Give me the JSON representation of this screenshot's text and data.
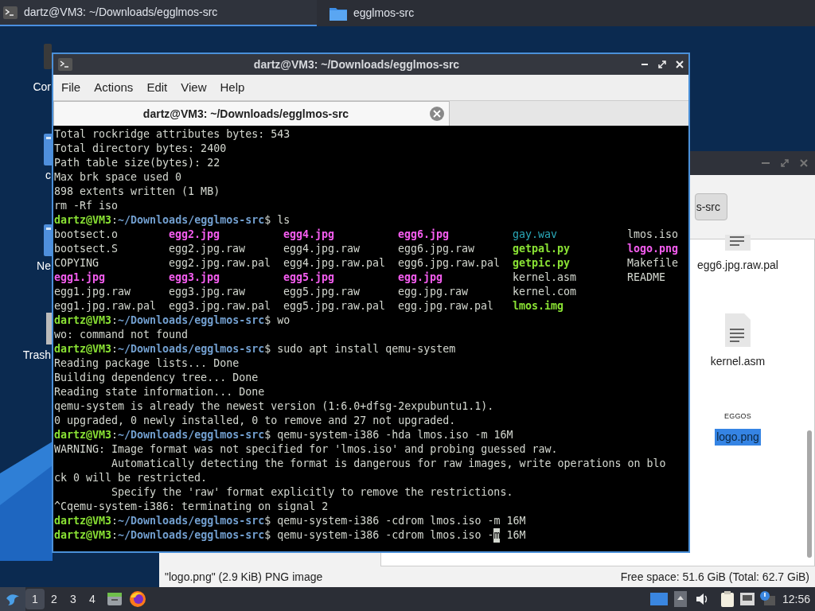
{
  "top_panel": {
    "tasks": [
      {
        "label": "dartz@VM3: ~/Downloads/egglmos-src",
        "kind": "terminal",
        "selected": true
      },
      {
        "label": "egglmos-src",
        "kind": "folder",
        "selected": false
      }
    ]
  },
  "desktop_icons": [
    {
      "label": "Cor",
      "kind": "computer"
    },
    {
      "label": "c",
      "kind": "folder"
    },
    {
      "label": "Ne",
      "kind": "folder"
    },
    {
      "label": "Trash",
      "kind": "trash"
    }
  ],
  "file_manager": {
    "path_button": "s-src",
    "files": [
      {
        "name": "egg6.jpg.raw.pal",
        "kind": "text",
        "selected": false
      },
      {
        "name": "kernel.asm",
        "kind": "text",
        "selected": false
      },
      {
        "name": "logo.png",
        "kind": "image",
        "thumbnail_text": "EGGOS",
        "selected": true
      }
    ],
    "status_left": "\"logo.png\" (2.9 KiB) PNG image",
    "status_right": "Free space: 51.6 GiB (Total: 62.7 GiB)"
  },
  "terminal": {
    "title": "dartz@VM3: ~/Downloads/egglmos-src",
    "menu": [
      "File",
      "Actions",
      "Edit",
      "View",
      "Help"
    ],
    "tab": {
      "label": "dartz@VM3: ~/Downloads/egglmos-src",
      "selected": true
    },
    "lines": [
      {
        "kind": "output",
        "text": "Total rockridge attributes bytes: 543"
      },
      {
        "kind": "output",
        "text": "Total directory bytes: 2400"
      },
      {
        "kind": "output",
        "text": "Path table size(bytes): 22"
      },
      {
        "kind": "output",
        "text": "Max brk space used 0"
      },
      {
        "kind": "output",
        "text": "898 extents written (1 MB)"
      },
      {
        "kind": "output",
        "text": "rm -Rf iso"
      },
      {
        "kind": "prompt",
        "user": "dartz@VM3",
        "separator": ":",
        "path": "~/Downloads/egglmos-src",
        "symbol": "$",
        "command": "ls"
      },
      {
        "kind": "listing",
        "rows": [
          [
            {
              "name": "bootsect.o",
              "kind": "file"
            },
            {
              "name": "egg2.jpg",
              "kind": "image"
            },
            {
              "name": "egg4.jpg",
              "kind": "image"
            },
            {
              "name": "egg6.jpg",
              "kind": "image"
            },
            {
              "name": "gay.wav",
              "kind": "audio"
            },
            {
              "name": "lmos.iso",
              "kind": "file"
            }
          ],
          [
            {
              "name": "bootsect.S",
              "kind": "file"
            },
            {
              "name": "egg2.jpg.raw",
              "kind": "file"
            },
            {
              "name": "egg4.jpg.raw",
              "kind": "file"
            },
            {
              "name": "egg6.jpg.raw",
              "kind": "file"
            },
            {
              "name": "getpal.py",
              "kind": "executable"
            },
            {
              "name": "logo.png",
              "kind": "image"
            }
          ],
          [
            {
              "name": "COPYING",
              "kind": "file"
            },
            {
              "name": "egg2.jpg.raw.pal",
              "kind": "file"
            },
            {
              "name": "egg4.jpg.raw.pal",
              "kind": "file"
            },
            {
              "name": "egg6.jpg.raw.pal",
              "kind": "file"
            },
            {
              "name": "getpic.py",
              "kind": "executable"
            },
            {
              "name": "Makefile",
              "kind": "file"
            }
          ],
          [
            {
              "name": "egg1.jpg",
              "kind": "image"
            },
            {
              "name": "egg3.jpg",
              "kind": "image"
            },
            {
              "name": "egg5.jpg",
              "kind": "image"
            },
            {
              "name": "egg.jpg",
              "kind": "image"
            },
            {
              "name": "kernel.asm",
              "kind": "file"
            },
            {
              "name": "README",
              "kind": "file"
            }
          ],
          [
            {
              "name": "egg1.jpg.raw",
              "kind": "file"
            },
            {
              "name": "egg3.jpg.raw",
              "kind": "file"
            },
            {
              "name": "egg5.jpg.raw",
              "kind": "file"
            },
            {
              "name": "egg.jpg.raw",
              "kind": "file"
            },
            {
              "name": "kernel.com",
              "kind": "file"
            }
          ],
          [
            {
              "name": "egg1.jpg.raw.pal",
              "kind": "file"
            },
            {
              "name": "egg3.jpg.raw.pal",
              "kind": "file"
            },
            {
              "name": "egg5.jpg.raw.pal",
              "kind": "file"
            },
            {
              "name": "egg.jpg.raw.pal",
              "kind": "file"
            },
            {
              "name": "lmos.img",
              "kind": "executable"
            }
          ]
        ]
      },
      {
        "kind": "prompt",
        "user": "dartz@VM3",
        "separator": ":",
        "path": "~/Downloads/egglmos-src",
        "symbol": "$",
        "command": "wo"
      },
      {
        "kind": "output",
        "text": "wo: command not found"
      },
      {
        "kind": "prompt",
        "user": "dartz@VM3",
        "separator": ":",
        "path": "~/Downloads/egglmos-src",
        "symbol": "$",
        "command": "sudo apt install qemu-system"
      },
      {
        "kind": "output",
        "text": "Reading package lists... Done"
      },
      {
        "kind": "output",
        "text": "Building dependency tree... Done"
      },
      {
        "kind": "output",
        "text": "Reading state information... Done"
      },
      {
        "kind": "output",
        "text": "qemu-system is already the newest version (1:6.0+dfsg-2expubuntu1.1)."
      },
      {
        "kind": "output",
        "text": "0 upgraded, 0 newly installed, 0 to remove and 27 not upgraded."
      },
      {
        "kind": "prompt",
        "user": "dartz@VM3",
        "separator": ":",
        "path": "~/Downloads/egglmos-src",
        "symbol": "$",
        "command": "qemu-system-i386 -hda lmos.iso -m 16M"
      },
      {
        "kind": "output",
        "text": "WARNING: Image format was not specified for 'lmos.iso' and probing guessed raw."
      },
      {
        "kind": "output",
        "text": "         Automatically detecting the format is dangerous for raw images, write operations on blo"
      },
      {
        "kind": "output",
        "text": "ck 0 will be restricted."
      },
      {
        "kind": "output",
        "text": "         Specify the 'raw' format explicitly to remove the restrictions."
      },
      {
        "kind": "output",
        "text": "^Cqemu-system-i386: terminating on signal 2"
      },
      {
        "kind": "prompt",
        "user": "dartz@VM3",
        "separator": ":",
        "path": "~/Downloads/egglmos-src",
        "symbol": "$",
        "command": "qemu-system-i386 -cdrom lmos.iso -m 16M"
      },
      {
        "kind": "prompt",
        "user": "dartz@VM3",
        "separator": ":",
        "path": "~/Downloads/egglmos-src",
        "symbol": "$",
        "command": "qemu-system-i386 -cdrom lmos.iso -",
        "cursor_char": "m",
        "command_rest": " 16M"
      }
    ]
  },
  "taskbar": {
    "workspaces": [
      {
        "label": "1",
        "selected": true
      },
      {
        "label": "2",
        "selected": false
      },
      {
        "label": "3",
        "selected": false
      },
      {
        "label": "4",
        "selected": false
      }
    ],
    "clock": "12:56"
  }
}
